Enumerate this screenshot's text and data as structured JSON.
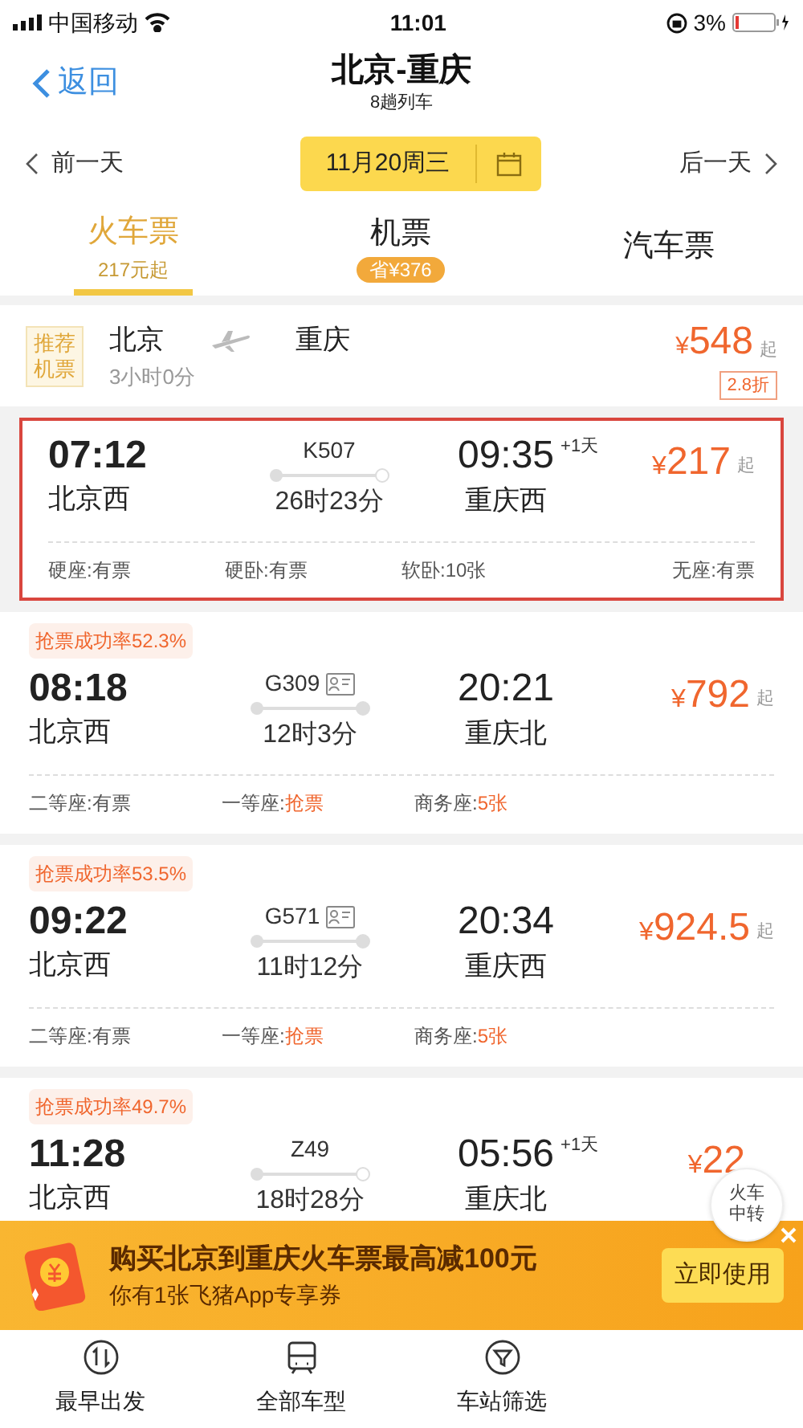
{
  "status_bar": {
    "carrier": "中国移动",
    "time": "11:01",
    "battery": "3%"
  },
  "nav": {
    "back": "返回",
    "title": "北京-重庆",
    "subtitle": "8趟列车"
  },
  "date_bar": {
    "prev": "前一天",
    "date": "11月20周三",
    "next": "后一天"
  },
  "tabs": [
    {
      "label": "火车票",
      "sub": "217元起",
      "selected": true
    },
    {
      "label": "机票",
      "badge": "省¥376",
      "selected": false
    },
    {
      "label": "汽车票",
      "selected": false
    }
  ],
  "flight": {
    "tag": "推荐机票",
    "from": "北京",
    "to": "重庆",
    "duration": "3小时0分",
    "currency": "¥",
    "price": "548",
    "suffix": "起",
    "discount": "2.8折"
  },
  "trains": [
    {
      "selected": true,
      "dep_time": "07:12",
      "dep_station": "北京西",
      "train_no": "K507",
      "id_icon": false,
      "duration": "26时23分",
      "arr_time": "09:35",
      "next_day": "+1天",
      "arr_station": "重庆西",
      "currency": "¥",
      "price": "217",
      "suffix": "起",
      "seats": [
        {
          "label": "硬座:",
          "value": "有票",
          "highlight": false
        },
        {
          "label": "硬卧:",
          "value": "有票",
          "highlight": false
        },
        {
          "label": "软卧:",
          "value": "10张",
          "highlight": false
        },
        {
          "label": "无座:",
          "value": "有票",
          "highlight": false
        }
      ]
    },
    {
      "selected": false,
      "success_rate": "抢票成功率52.3%",
      "dep_time": "08:18",
      "dep_station": "北京西",
      "train_no": "G309",
      "id_icon": true,
      "duration": "12时3分",
      "arr_time": "20:21",
      "arr_station": "重庆北",
      "currency": "¥",
      "price": "792",
      "suffix": "起",
      "seats": [
        {
          "label": "二等座:",
          "value": "有票",
          "highlight": false
        },
        {
          "label": "一等座:",
          "value": "抢票",
          "highlight": true
        },
        {
          "label": "商务座:",
          "value": "5张",
          "highlight": true
        }
      ]
    },
    {
      "selected": false,
      "success_rate": "抢票成功率53.5%",
      "dep_time": "09:22",
      "dep_station": "北京西",
      "train_no": "G571",
      "id_icon": true,
      "duration": "11时12分",
      "arr_time": "20:34",
      "arr_station": "重庆西",
      "currency": "¥",
      "price": "924.5",
      "suffix": "起",
      "seats": [
        {
          "label": "二等座:",
          "value": "有票",
          "highlight": false
        },
        {
          "label": "一等座:",
          "value": "抢票",
          "highlight": true
        },
        {
          "label": "商务座:",
          "value": "5张",
          "highlight": true
        }
      ]
    },
    {
      "selected": false,
      "success_rate": "抢票成功率49.7%",
      "dep_time": "11:28",
      "dep_station": "北京西",
      "train_no": "Z49",
      "id_icon": false,
      "duration": "18时28分",
      "arr_time": "05:56",
      "next_day": "+1天",
      "arr_station": "重庆北",
      "currency": "¥",
      "price": "22"
    }
  ],
  "transfer_button": "火车中转",
  "promo": {
    "title": "购买北京到重庆火车票最高减100元",
    "subtitle": "你有1张飞猪App专享券",
    "button": "立即使用"
  },
  "bottom_nav": [
    {
      "kind": "sort",
      "label": "最早出发"
    },
    {
      "kind": "train",
      "label": "全部车型"
    },
    {
      "kind": "filter",
      "label": "车站筛选"
    }
  ]
}
